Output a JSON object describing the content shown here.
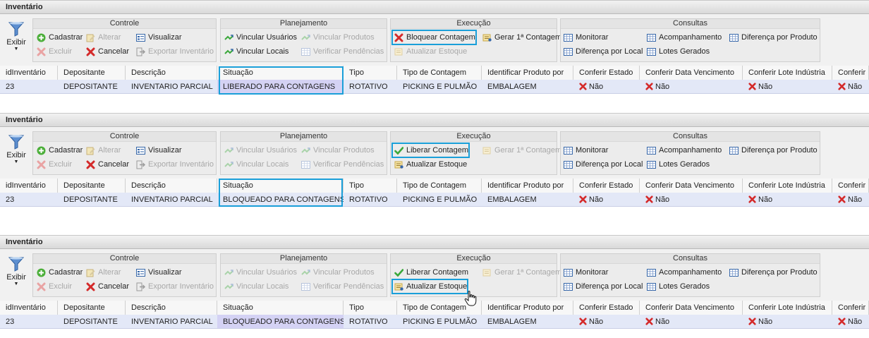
{
  "colors": {
    "highlight": "#1a9fd9",
    "row": "#e3e8f7",
    "selected_cell": "#d4d2f4",
    "accent_red": "#d42a2a",
    "accent_green": "#3aa83a"
  },
  "panels": [
    {
      "title": "Inventário",
      "exibir": "Exibir",
      "groups": {
        "controle": "Controle",
        "planejamento": "Planejamento",
        "execucao": "Execução",
        "consultas": "Consultas"
      },
      "controle": {
        "cadastrar": "Cadastrar",
        "alterar": "Alterar",
        "visualizar": "Visualizar",
        "excluir": "Excluir",
        "cancelar": "Cancelar",
        "exportar": "Exportar Inventário"
      },
      "planejamento": {
        "vincular_usuarios": "Vincular Usuários",
        "vincular_produtos": "Vincular Produtos",
        "vincular_locais": "Vincular Locais",
        "verificar_pendencias": "Verificar Pendências"
      },
      "execucao": {
        "toggle": "Bloquear Contagem",
        "gerar": "Gerar 1ª Contagem",
        "atualizar": "Atualizar Estoque"
      },
      "consultas": {
        "monitorar": "Monitorar",
        "acompanhamento": "Acompanhamento",
        "diferenca_produto": "Diferença por Produto",
        "diferenca_local": "Diferença por Local",
        "lotes": "Lotes Gerados"
      },
      "columns": [
        "idInventário",
        "Depositante",
        "Descrição",
        "Situação",
        "Tipo",
        "Tipo de Contagem",
        "Identificar Produto por",
        "Conferir Estado",
        "Conferir Data Vencimento",
        "Conferir Lote Indústria",
        "Conferir"
      ],
      "row": [
        "23",
        "DEPOSITANTE",
        "INVENTARIO PARCIAL",
        "LIBERADO PARA CONTAGENS",
        "ROTATIVO",
        "PICKING E PULMÃO",
        "EMBALAGEM",
        "Não",
        "Não",
        "Não",
        "Não"
      ]
    },
    {
      "title": "Inventário",
      "exibir": "Exibir",
      "groups": {
        "controle": "Controle",
        "planejamento": "Planejamento",
        "execucao": "Execução",
        "consultas": "Consultas"
      },
      "controle": {
        "cadastrar": "Cadastrar",
        "alterar": "Alterar",
        "visualizar": "Visualizar",
        "excluir": "Excluir",
        "cancelar": "Cancelar",
        "exportar": "Exportar Inventário"
      },
      "planejamento": {
        "vincular_usuarios": "Vincular Usuários",
        "vincular_produtos": "Vincular Produtos",
        "vincular_locais": "Vincular Locais",
        "verificar_pendencias": "Verificar Pendências"
      },
      "execucao": {
        "toggle": "Liberar Contagem",
        "gerar": "Gerar 1ª Contagem",
        "atualizar": "Atualizar Estoque"
      },
      "consultas": {
        "monitorar": "Monitorar",
        "acompanhamento": "Acompanhamento",
        "diferenca_produto": "Diferença por Produto",
        "diferenca_local": "Diferença por Local",
        "lotes": "Lotes Gerados"
      },
      "columns": [
        "idInventário",
        "Depositante",
        "Descrição",
        "Situação",
        "Tipo",
        "Tipo de Contagem",
        "Identificar Produto por",
        "Conferir Estado",
        "Conferir Data Vencimento",
        "Conferir Lote Indústria",
        "Conferir"
      ],
      "row": [
        "23",
        "DEPOSITANTE",
        "INVENTARIO PARCIAL",
        "BLOQUEADO PARA CONTAGENS",
        "ROTATIVO",
        "PICKING E PULMÃO",
        "EMBALAGEM",
        "Não",
        "Não",
        "Não",
        "Não"
      ]
    },
    {
      "title": "Inventário",
      "exibir": "Exibir",
      "groups": {
        "controle": "Controle",
        "planejamento": "Planejamento",
        "execucao": "Execução",
        "consultas": "Consultas"
      },
      "controle": {
        "cadastrar": "Cadastrar",
        "alterar": "Alterar",
        "visualizar": "Visualizar",
        "excluir": "Excluir",
        "cancelar": "Cancelar",
        "exportar": "Exportar Inventário"
      },
      "planejamento": {
        "vincular_usuarios": "Vincular Usuários",
        "vincular_produtos": "Vincular Produtos",
        "vincular_locais": "Vincular Locais",
        "verificar_pendencias": "Verificar Pendências"
      },
      "execucao": {
        "toggle": "Liberar Contagem",
        "gerar": "Gerar 1ª Contagem",
        "atualizar": "Atualizar Estoque"
      },
      "consultas": {
        "monitorar": "Monitorar",
        "acompanhamento": "Acompanhamento",
        "diferenca_produto": "Diferença por Produto",
        "diferenca_local": "Diferença por Local",
        "lotes": "Lotes Gerados"
      },
      "columns": [
        "idInventário",
        "Depositante",
        "Descrição",
        "Situação",
        "Tipo",
        "Tipo de Contagem",
        "Identificar Produto por",
        "Conferir Estado",
        "Conferir Data Vencimento",
        "Conferir Lote Indústria",
        "Conferir"
      ],
      "row": [
        "23",
        "DEPOSITANTE",
        "INVENTARIO PARCIAL",
        "BLOQUEADO PARA CONTAGENS",
        "ROTATIVO",
        "PICKING E PULMÃO",
        "EMBALAGEM",
        "Não",
        "Não",
        "Não",
        "Não"
      ]
    }
  ]
}
